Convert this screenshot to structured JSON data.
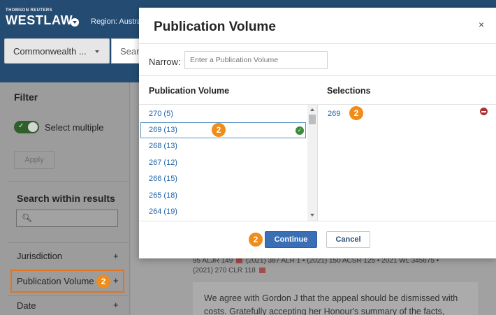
{
  "header": {
    "brand_top": "THOMSON REUTERS",
    "brand_name": "WESTLAW",
    "region_text": "Region: Austra"
  },
  "search": {
    "jurisdiction_value": "Commonwealth ...",
    "search_placeholder": "Searc"
  },
  "sidebar": {
    "filter_title": "Filter",
    "select_multiple_label": "Select multiple",
    "select_multiple_on": true,
    "apply_label": "Apply",
    "search_within_title": "Search within results",
    "facets": [
      {
        "label": "Jurisdiction",
        "toggle": "+"
      },
      {
        "label": "Publication Volume",
        "toggle": "+",
        "badge": "2",
        "highlighted": true
      },
      {
        "label": "Date",
        "toggle": "+"
      }
    ]
  },
  "results": {
    "citation_line_1": "95 ALJR 149",
    "citation_line_1_rest": "(2021) 387 ALR 1  •  (2021) 150 ACSR 125  •  2021 WL 345675  •",
    "citation_line_2": "(2021) 270 CLR 118",
    "excerpt": "We agree with Gordon J that the appeal should be dismissed with costs. Gratefully accepting her Honour's summary of the facts, issues"
  },
  "modal": {
    "title": "Publication Volume",
    "close_label": "×",
    "narrow_label": "Narrow:",
    "narrow_placeholder": "Enter a Publication Volume",
    "list_header": "Publication Volume",
    "selections_header": "Selections",
    "volumes": [
      "270 (5)",
      "269 (13)",
      "268 (13)",
      "267 (12)",
      "266 (15)",
      "265 (18)",
      "264 (19)"
    ],
    "selected_volume": "269 (13)",
    "selections": [
      "269"
    ],
    "continue_label": "Continue",
    "cancel_label": "Cancel",
    "badge_value": "2"
  },
  "colors": {
    "header_bg": "#244c73",
    "accent_blue": "#3a6fb6",
    "badge_orange": "#f08c19",
    "link_blue": "#1f64a8",
    "ok_green": "#3c8a3c",
    "remove_red": "#b03030"
  }
}
